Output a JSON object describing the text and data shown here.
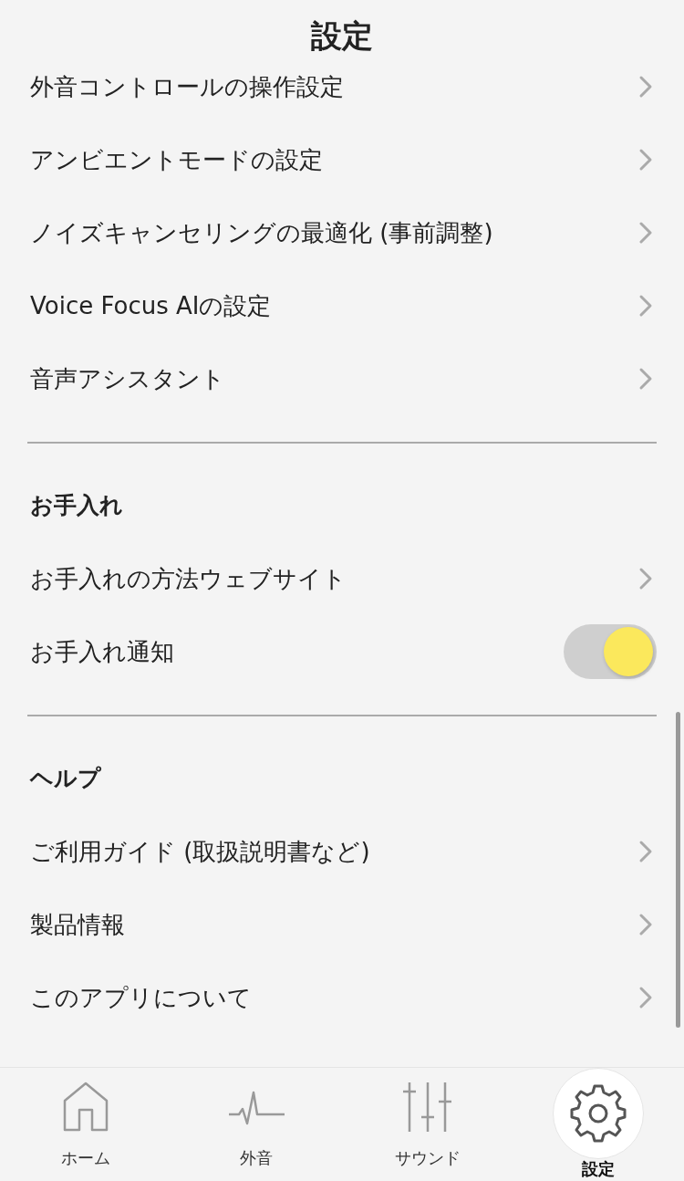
{
  "title": "設定",
  "sections": [
    {
      "items": [
        {
          "kind": "link",
          "label": "外音コントロールの操作設定"
        },
        {
          "kind": "link",
          "label": "アンビエントモードの設定"
        },
        {
          "kind": "link",
          "label": "ノイズキャンセリングの最適化 (事前調整)"
        },
        {
          "kind": "link",
          "label": "Voice Focus AIの設定"
        },
        {
          "kind": "link",
          "label": "音声アシスタント"
        }
      ]
    },
    {
      "heading": "お手入れ",
      "items": [
        {
          "kind": "link",
          "label": "お手入れの方法ウェブサイト"
        },
        {
          "kind": "toggle",
          "label": "お手入れ通知",
          "on": true
        }
      ]
    },
    {
      "heading": "ヘルプ",
      "items": [
        {
          "kind": "link",
          "label": "ご利用ガイド (取扱説明書など)"
        },
        {
          "kind": "link",
          "label": "製品情報"
        },
        {
          "kind": "link",
          "label": "このアプリについて"
        }
      ]
    }
  ],
  "tabs": [
    {
      "kind": "home",
      "label": "ホーム",
      "selected": false
    },
    {
      "kind": "pulse",
      "label": "外音",
      "selected": false
    },
    {
      "kind": "sliders",
      "label": "サウンド",
      "selected": false
    },
    {
      "kind": "settings",
      "label": "設定",
      "selected": true
    }
  ]
}
